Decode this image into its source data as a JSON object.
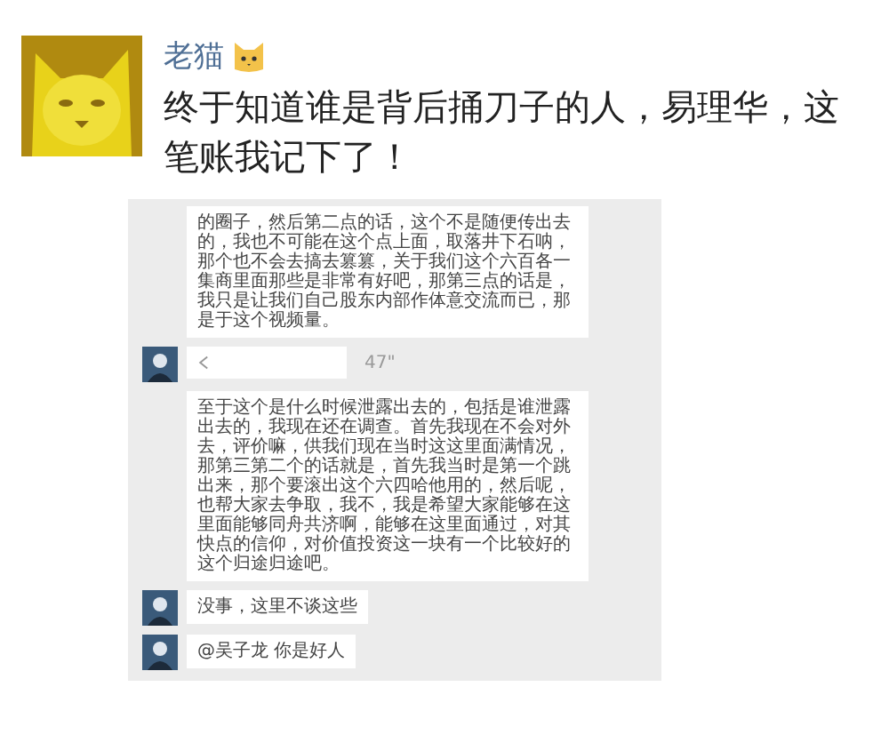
{
  "post": {
    "author": "老猫",
    "text": "终于知道谁是背后捅刀子的人，易理华，这笔账我记下了！"
  },
  "chat_screenshot": {
    "messages": [
      {
        "kind": "text",
        "avatar": false,
        "text": "的圈子，然后第二点的话，这个不是随便传出去的，我也不可能在这个点上面，取落井下石呐，那个也不会去搞去篡篡，关于我们这个六百各一集商里面那些是非常有好吧，那第三点的话是，我只是让我们自己股东内部作体意交流而已，那是于这个视频量。"
      },
      {
        "kind": "voice",
        "avatar": true,
        "duration": "47\""
      },
      {
        "kind": "text",
        "avatar": false,
        "text": "至于这个是什么时候泄露出去的，包括是谁泄露出去的，我现在还在调查。首先我现在不会对外去，评价嘛，供我们现在当时这这里面满情况，那第三第二个的话就是，首先我当时是第一个跳出来，那个要滚出这个六四哈他用的，然后呢，也帮大家去争取，我不，我是希望大家能够在这里面能够同舟共济啊，能够在这里面通过，对其快点的信仰，对价值投资这一块有一个比较好的这个归途归途吧。"
      },
      {
        "kind": "text",
        "avatar": true,
        "text": "没事，这里不谈这些"
      },
      {
        "kind": "text",
        "avatar": true,
        "text": "@吴子龙 你是好人"
      }
    ]
  }
}
